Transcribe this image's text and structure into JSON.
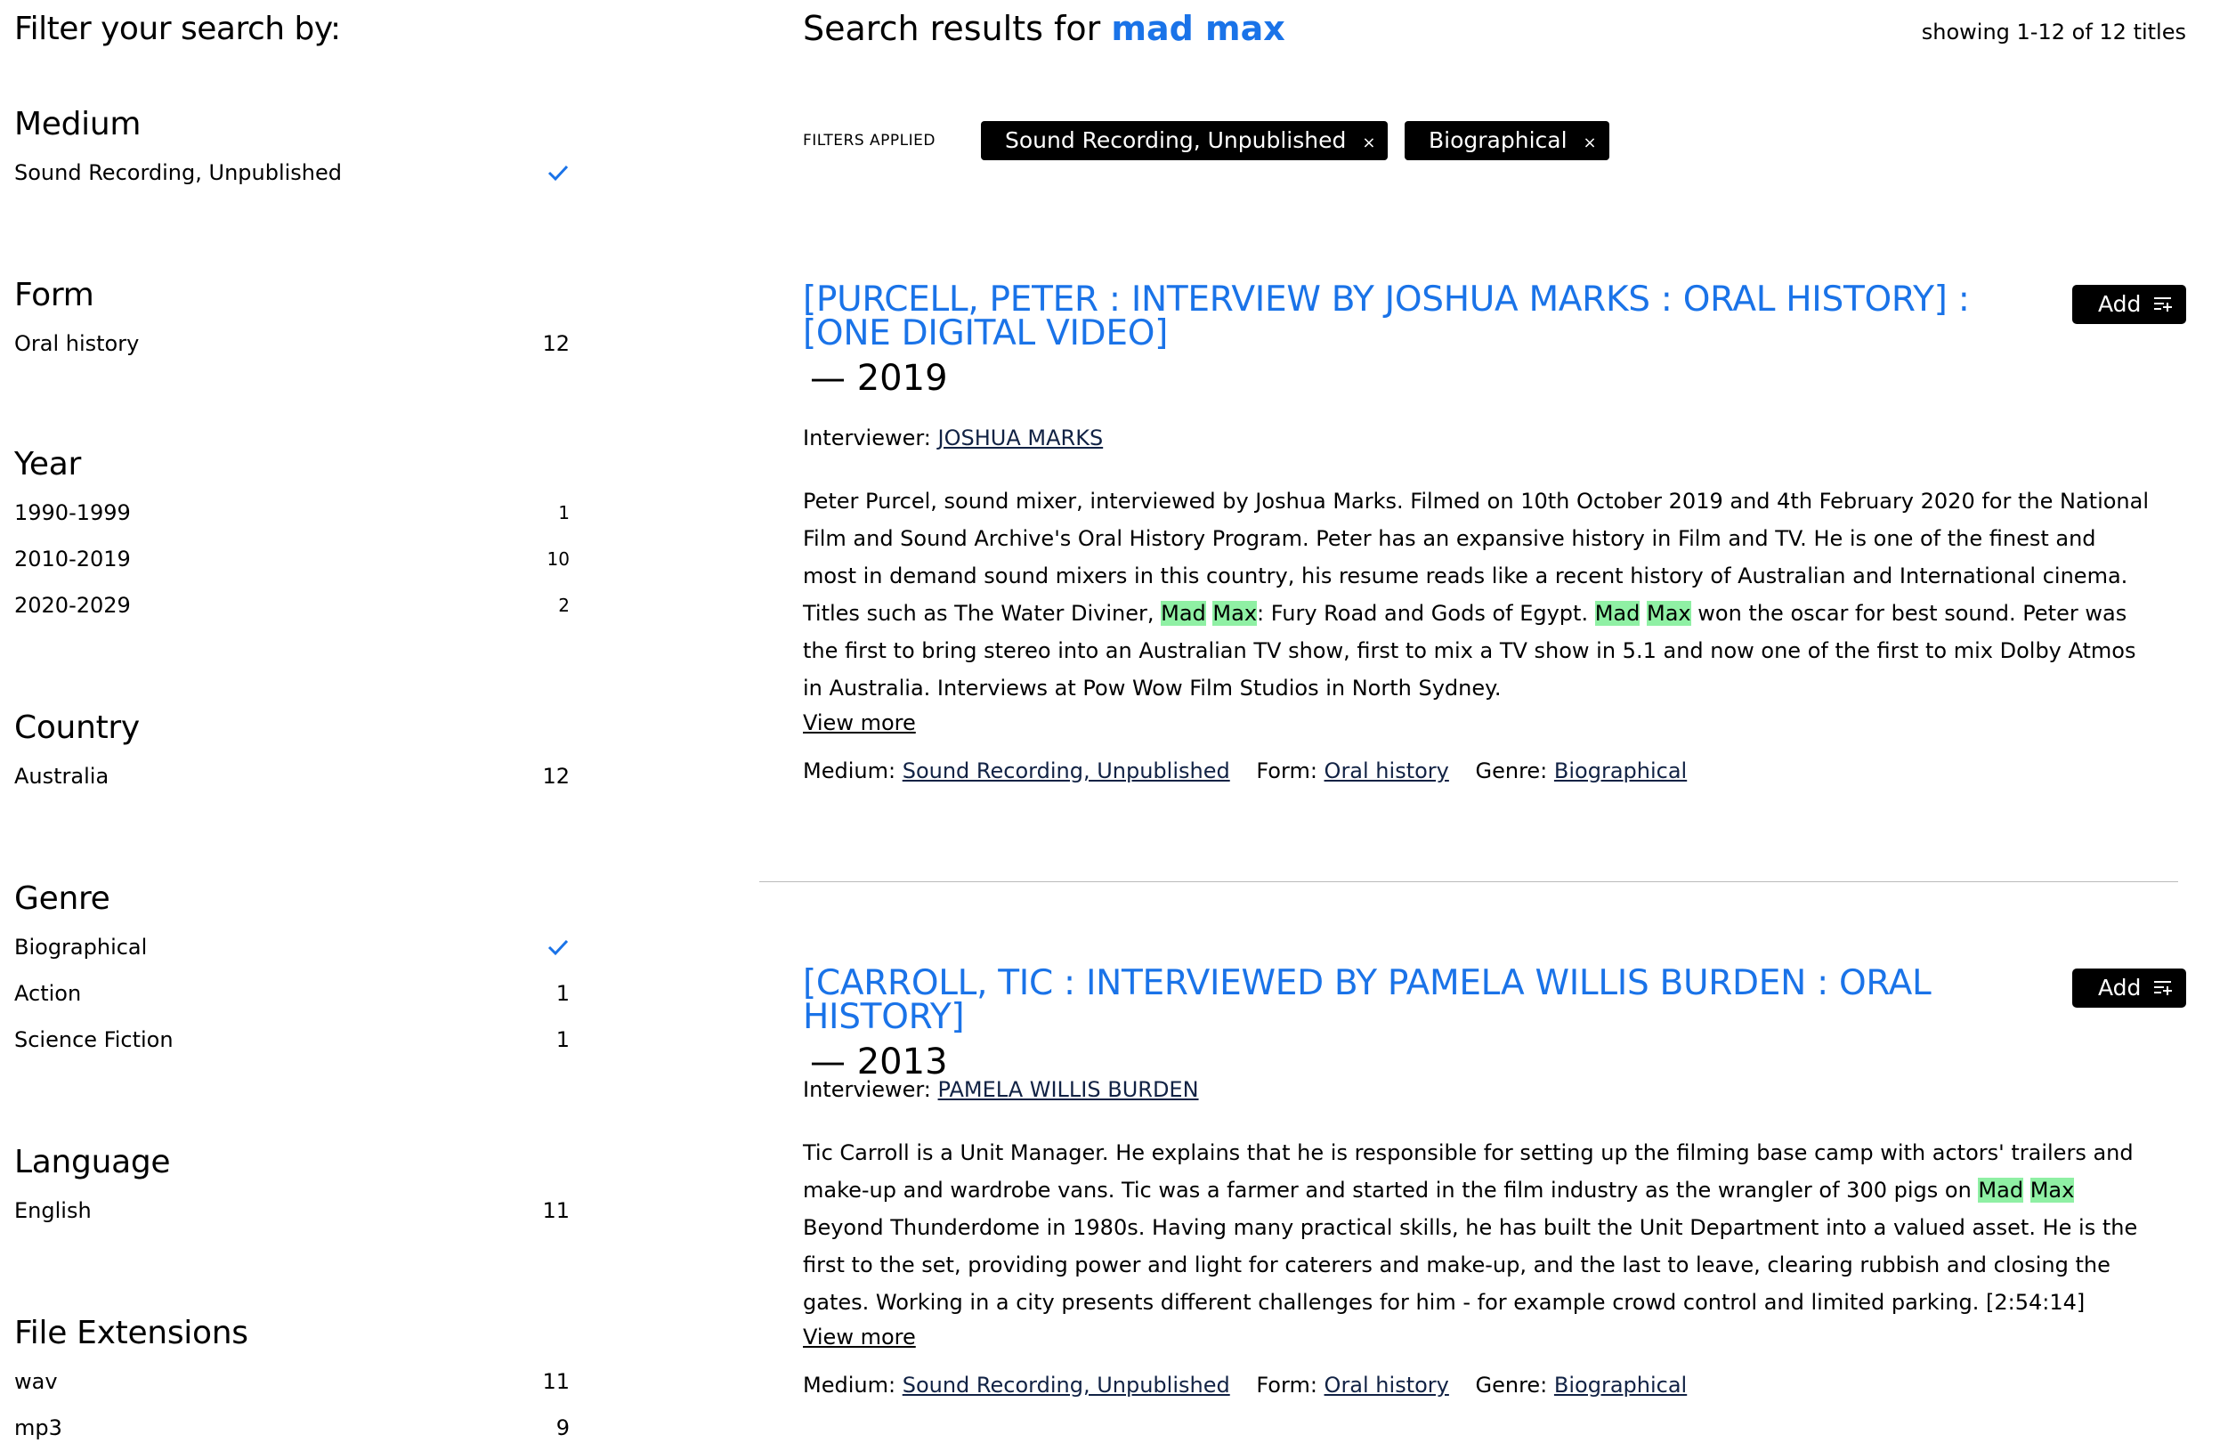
{
  "sidebar": {
    "title": "Filter your search by:",
    "facets": [
      {
        "title": "Medium",
        "items": [
          {
            "label": "Sound Recording, Unpublished",
            "checked": true
          }
        ]
      },
      {
        "title": "Form",
        "items": [
          {
            "label": "Oral history",
            "count": "12"
          }
        ]
      },
      {
        "title": "Year",
        "items": [
          {
            "label": "1990-1999",
            "count": "1"
          },
          {
            "label": "2010-2019",
            "count": "10"
          },
          {
            "label": "2020-2029",
            "count": "2"
          }
        ]
      },
      {
        "title": "Country",
        "items": [
          {
            "label": "Australia",
            "count": "12"
          }
        ]
      },
      {
        "title": "Genre",
        "items": [
          {
            "label": "Biographical",
            "checked": true
          },
          {
            "label": "Action",
            "count": "1"
          },
          {
            "label": "Science Fiction",
            "count": "1"
          }
        ]
      },
      {
        "title": "Language",
        "items": [
          {
            "label": "English",
            "count": "11"
          }
        ]
      },
      {
        "title": "File Extensions",
        "items": [
          {
            "label": "wav",
            "count": "11"
          },
          {
            "label": "mp3",
            "count": "9"
          }
        ]
      }
    ]
  },
  "header": {
    "search_prefix": "Search results for",
    "query": "mad max",
    "showing": "showing 1-12 of 12 titles"
  },
  "filters": {
    "label": "FILTERS APPLIED",
    "chips": [
      "Sound Recording, Unpublished",
      "Biographical"
    ],
    "remove_glyph": "×"
  },
  "results": [
    {
      "title": "[Purcell, Peter : interview by Joshua Marks : oral history] : [one digital video]",
      "year": "— 2019",
      "interviewer_label": "Interviewer:",
      "interviewer": "JOSHUA MARKS",
      "description": [
        {
          "t": "Peter Purcel, sound mixer, interviewed by Joshua Marks. Filmed on 10th October 2019 and 4th February 2020 for the National Film and Sound Archive's Oral History Program. Peter has an expansive history in Film and TV. He is one of the finest and most in demand sound mixers in this country, his resume reads like a recent history of Australian and International cinema. Titles such as The Water Diviner, "
        },
        {
          "t": "Mad",
          "hl": true
        },
        {
          "t": " "
        },
        {
          "t": "Max",
          "hl": true
        },
        {
          "t": ": Fury Road and Gods of Egypt. "
        },
        {
          "t": "Mad",
          "hl": true
        },
        {
          "t": " "
        },
        {
          "t": "Max",
          "hl": true
        },
        {
          "t": " won the oscar for best sound. Peter was the first to bring stereo into an Australian TV show, first to mix a TV show in 5.1 and now one of the first to mix Dolby Atmos in Australia. Interviews at Pow Wow Film Studios in North Sydney."
        }
      ],
      "view_more": "View more",
      "meta": [
        {
          "label": "Medium:",
          "value": "Sound Recording, Unpublished"
        },
        {
          "label": "Form:",
          "value": "Oral history"
        },
        {
          "label": "Genre:",
          "value": "Biographical"
        }
      ],
      "add_label": "Add"
    },
    {
      "title": "[Carroll, Tic : interviewed by Pamela Willis Burden : oral history]",
      "year": "— 2013",
      "interviewer_label": "Interviewer:",
      "interviewer": "PAMELA WILLIS BURDEN",
      "description": [
        {
          "t": "Tic Carroll is a Unit Manager. He explains that he is responsible for setting up the filming base camp with actors' trailers and make-up and wardrobe vans. Tic was a farmer and started in the film industry as the wrangler of 300 pigs on "
        },
        {
          "t": "Mad",
          "hl": true
        },
        {
          "t": " "
        },
        {
          "t": "Max",
          "hl": true
        },
        {
          "t": " Beyond Thunderdome in 1980s. Having many practical skills, he has built the Unit Department into a valued asset. He is the first to the set, providing power and light for caterers and make-up, and the last to leave, clearing rubbish and closing the gates. Working in a city presents different challenges for him - for example crowd control and limited parking. [2:54:14]"
        }
      ],
      "view_more": "View more",
      "meta": [
        {
          "label": "Medium:",
          "value": "Sound Recording, Unpublished"
        },
        {
          "label": "Form:",
          "value": "Oral history"
        },
        {
          "label": "Genre:",
          "value": "Biographical"
        }
      ],
      "add_label": "Add"
    }
  ],
  "colors": {
    "link": "#1a73e8",
    "highlight": "#8ff0a4",
    "chip_bg": "#000000"
  }
}
